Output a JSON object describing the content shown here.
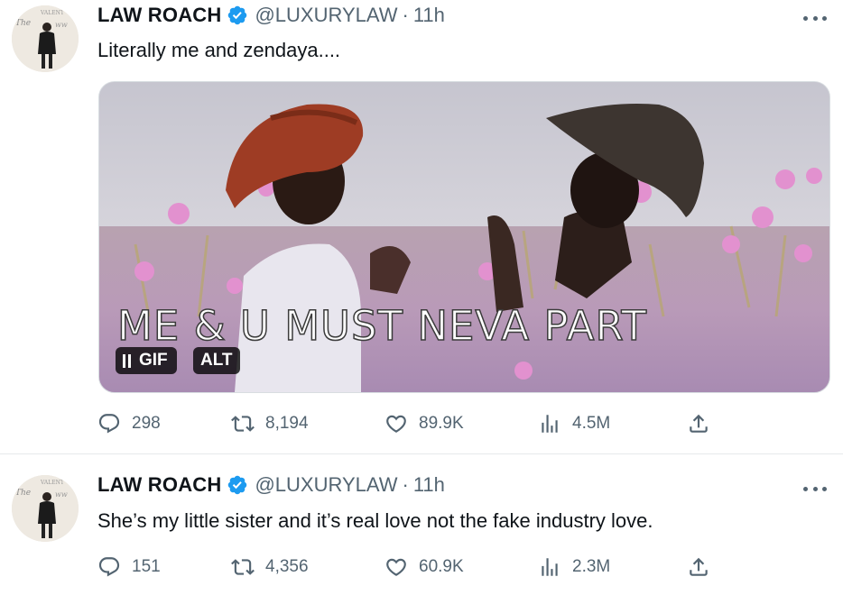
{
  "tweets": [
    {
      "author": "LAW ROACH",
      "handle": "@LUXURYLAW",
      "separator": "·",
      "time": "11h",
      "text": "Literally me and zendaya....",
      "media": {
        "caption": "ME & U MUST NEVA PART",
        "gif_label": "GIF",
        "alt_label": "ALT"
      },
      "stats": {
        "replies": "298",
        "retweets": "8,194",
        "likes": "89.9K",
        "views": "4.5M"
      }
    },
    {
      "author": "LAW ROACH",
      "handle": "@LUXURYLAW",
      "separator": "·",
      "time": "11h",
      "text": "She’s my little sister and it’s real love not the fake industry love.",
      "stats": {
        "replies": "151",
        "retweets": "4,356",
        "likes": "60.9K",
        "views": "2.3M"
      }
    }
  ],
  "icons": {
    "verified": "verified-badge-icon",
    "more": "more-icon",
    "reply": "reply-icon",
    "retweet": "retweet-icon",
    "like": "heart-icon",
    "views": "views-icon",
    "share": "share-icon"
  },
  "colors": {
    "verified": "#1d9bf0",
    "secondary_text": "#536471",
    "primary_text": "#0f1419"
  }
}
